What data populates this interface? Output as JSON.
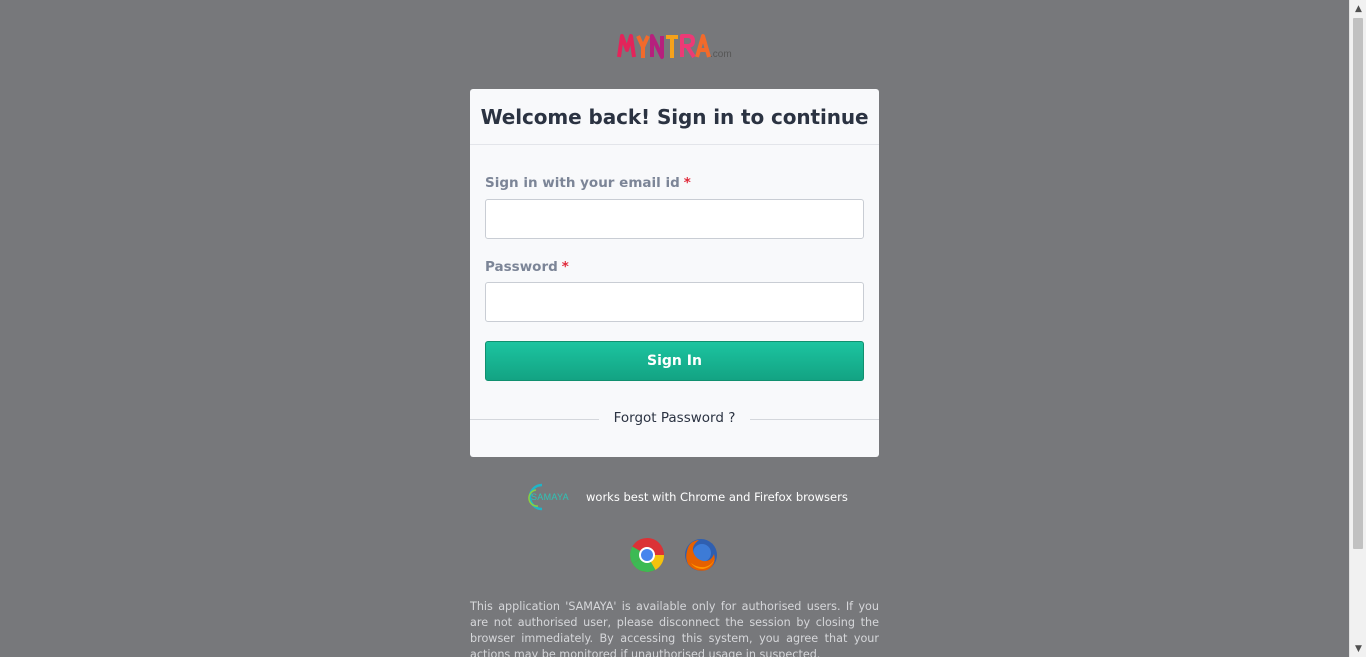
{
  "brand": {
    "logo_text": "MYNTRA",
    "logo_suffix": ".com"
  },
  "login_card": {
    "title": "Welcome back! Sign in to continue",
    "email_label": "Sign in with your email id",
    "email_value": "",
    "password_label": "Password",
    "password_value": "",
    "required_marker": "*",
    "sign_in_label": "Sign In",
    "forgot_password_label": "Forgot Password ?"
  },
  "footer": {
    "samaya_logo_text": "SAMAYA",
    "works_best_text": "works best with Chrome and Firefox browsers",
    "browsers": [
      "chrome-icon",
      "firefox-icon"
    ],
    "disclaimer": "This application 'SAMAYA' is available only for authorised users. If you are not authorised user, please disconnect the session by closing the browser immediately. By accessing this system, you agree that your actions may be monitored if unauthorised usage in suspected."
  },
  "colors": {
    "background": "#77787b",
    "primary_button": "#17b592",
    "required": "#e02a3a"
  }
}
